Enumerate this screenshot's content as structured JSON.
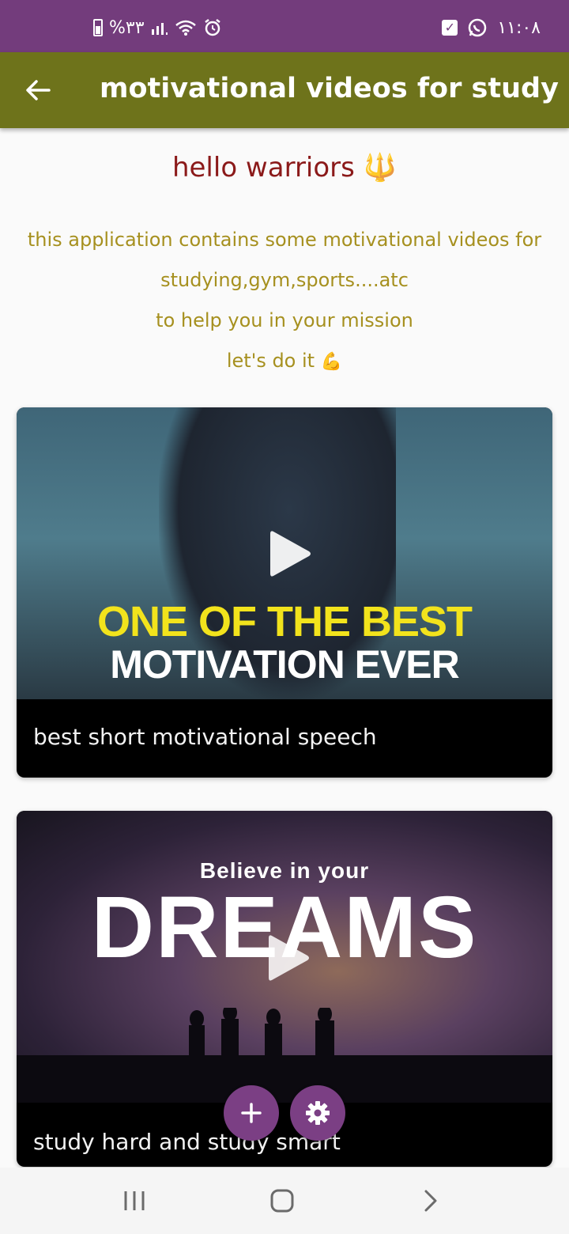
{
  "status_bar": {
    "left_text": "%٣٣",
    "time": "١١:٠٨",
    "icons": [
      "battery-icon",
      "signal-icon",
      "wifi-icon",
      "alarm-icon",
      "checkbox-notification-icon",
      "whatsapp-icon"
    ]
  },
  "app_bar": {
    "title": "motivational videos for study",
    "back_icon": "arrow-left-icon",
    "background": "#6e731b"
  },
  "intro": {
    "greeting": "hello warriors",
    "greeting_emoji": "🔱",
    "lines": [
      "this application contains some motivational videos for",
      "studying,gym,sports....atc",
      "to help you in your mission",
      "let's do it"
    ],
    "closing_emoji": "💪"
  },
  "videos": [
    {
      "thumbnail_line1": "ONE OF THE BEST",
      "thumbnail_line2": "MOTIVATION EVER",
      "caption": "best short motivational speech"
    },
    {
      "thumbnail_line1": "Believe in your",
      "thumbnail_line2": "DREAMS",
      "caption": "study hard and study smart"
    }
  ],
  "fabs": [
    {
      "icon": "plus-icon"
    },
    {
      "icon": "gear-icon"
    }
  ],
  "nav_bar": {
    "icons": [
      "recent-apps-icon",
      "home-icon",
      "back-icon"
    ]
  },
  "colors": {
    "status_bar": "#733c7c",
    "app_bar": "#6e731b",
    "greeting": "#8b1a1a",
    "intro_text": "#a6901f",
    "fab": "#7b3f84"
  }
}
